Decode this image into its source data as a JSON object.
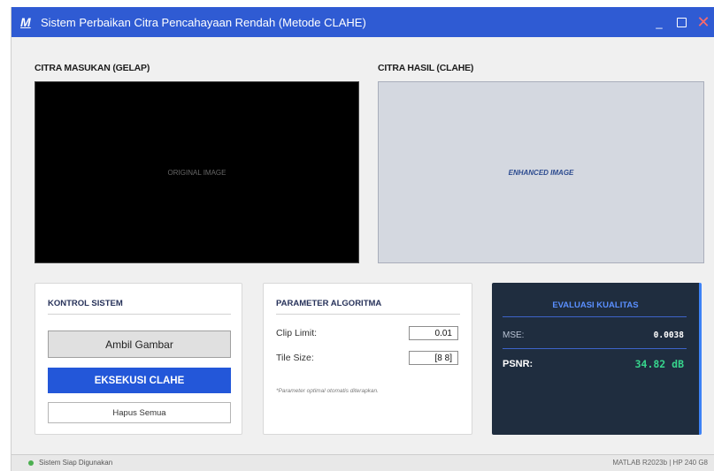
{
  "window": {
    "logo": "M",
    "title": "Sistem Perbaikan Citra Pencahayaan Rendah (Metode CLAHE)",
    "controls": {
      "minimize": "_",
      "close": "✕"
    }
  },
  "images": {
    "input_label": "CITRA MASUKAN (GELAP)",
    "input_placeholder": "ORIGINAL IMAGE",
    "output_label": "CITRA HASIL (CLAHE)",
    "output_placeholder": "ENHANCED IMAGE"
  },
  "kontrol": {
    "title": "KONTROL SISTEM",
    "ambil_label": "Ambil Gambar",
    "eksekusi_label": "EKSEKUSI CLAHE",
    "hapus_label": "Hapus Semua"
  },
  "parameter": {
    "title": "PARAMETER ALGORITMA",
    "clip_label": "Clip Limit:",
    "clip_value": "0.01",
    "tile_label": "Tile Size:",
    "tile_value": "[8 8]",
    "note": "*Parameter optimal otomatis diterapkan."
  },
  "evaluasi": {
    "title": "EVALUASI KUALITAS",
    "mse_label": "MSE:",
    "mse_value": "0.0038",
    "psnr_label": "PSNR:",
    "psnr_value": "34.82 dB"
  },
  "status": {
    "text": "Sistem Siap Digunakan",
    "right": "MATLAB R2023b | HP 240 G8"
  },
  "colors": {
    "titlebar": "#2f5bd3",
    "primary_button": "#2357d9",
    "eval_bg": "#1f2d3f",
    "psnr_accent": "#37d58d",
    "status_ok": "#4caf50"
  },
  "icons": [
    "matlab-logo-icon",
    "minimize-icon",
    "maximize-icon",
    "close-icon",
    "status-dot-icon"
  ]
}
